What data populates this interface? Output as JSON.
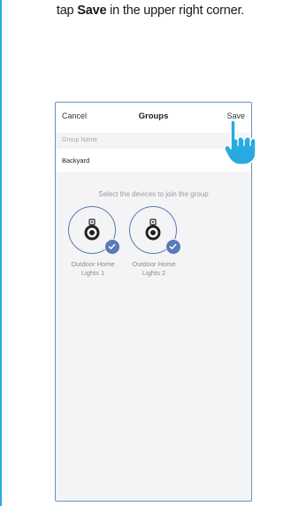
{
  "instruction": {
    "prefix": "tap ",
    "bold": "Save",
    "suffix": " in the upper right corner."
  },
  "nav": {
    "cancel_label": "Cancel",
    "title": "Groups",
    "save_label": "Save"
  },
  "group_name": {
    "label": "Group Name",
    "value": "Backyard"
  },
  "prompt": "Select the devices to join the group",
  "devices": [
    {
      "name_line1": "Outdoor Home",
      "name_line2": "Lights 1",
      "selected": true
    },
    {
      "name_line1": "Outdoor Home",
      "name_line2": "Lights 2",
      "selected": true
    }
  ],
  "colors": {
    "accent": "#5b78b8",
    "pointer": "#29a9e0",
    "frame": "#6b8fc4"
  },
  "icons": {
    "pointer": "pointing-hand-icon",
    "check": "checkmark-icon",
    "device": "outdoor-light-icon"
  }
}
